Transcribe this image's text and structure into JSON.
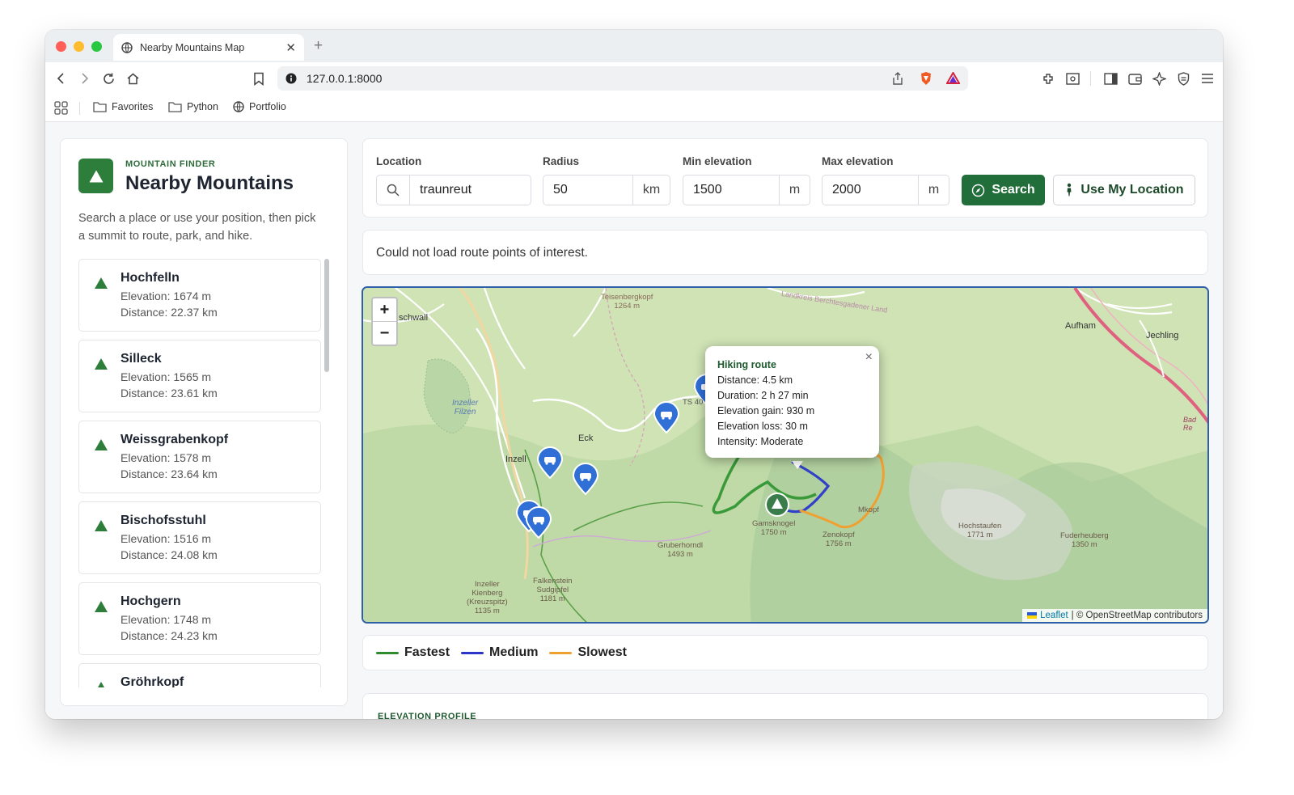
{
  "browser": {
    "tab_title": "Nearby Mountains Map",
    "url": "127.0.0.1:8000",
    "bookmarks": [
      "Favorites",
      "Python",
      "Portfolio"
    ],
    "traffic_light_colors": [
      "#fe5f57",
      "#febc2e",
      "#28c840"
    ]
  },
  "sidebar": {
    "eyebrow": "MOUNTAIN FINDER",
    "title": "Nearby Mountains",
    "intro": "Search a place or use your position, then pick a summit to route, park, and hike.",
    "mountains": [
      {
        "name": "Hochfelln",
        "elevation": "Elevation: 1674 m",
        "distance": "Distance: 22.37 km"
      },
      {
        "name": "Silleck",
        "elevation": "Elevation: 1565 m",
        "distance": "Distance: 23.61 km"
      },
      {
        "name": "Weissgrabenkopf",
        "elevation": "Elevation: 1578 m",
        "distance": "Distance: 23.64 km"
      },
      {
        "name": "Bischofsstuhl",
        "elevation": "Elevation: 1516 m",
        "distance": "Distance: 24.08 km"
      },
      {
        "name": "Hochgern",
        "elevation": "Elevation: 1748 m",
        "distance": "Distance: 24.23 km"
      },
      {
        "name": "Gröhrkopf",
        "elevation": "",
        "distance": ""
      }
    ]
  },
  "search": {
    "location_label": "Location",
    "location_value": "traunreut",
    "radius_label": "Radius",
    "radius_value": "50",
    "radius_unit": "km",
    "min_label": "Min elevation",
    "min_value": "1500",
    "min_unit": "m",
    "max_label": "Max elevation",
    "max_value": "2000",
    "max_unit": "m",
    "search_button": "Search",
    "location_button": "Use My Location"
  },
  "notice": "Could not load route points of interest.",
  "map": {
    "zoom_in": "+",
    "zoom_out": "−",
    "attribution_link": "Leaflet",
    "attribution_text": "| © OpenStreetMap contributors",
    "popup": {
      "title": "Hiking route",
      "distance": "Distance: 4.5 km",
      "duration": "Duration: 2 h 27 min",
      "gain": "Elevation gain: 930 m",
      "loss": "Elevation loss: 30 m",
      "intensity": "Intensity: Moderate",
      "close": "×"
    },
    "labels": {
      "inzell": "Inzell",
      "eck": "Eck",
      "aufham": "Aufham",
      "jechling": "Jechling",
      "schwall": "schwall",
      "teisenberg": "Teisenbergkopf",
      "teisenberg_elev": "1264 m",
      "gamsknogel": "Gamsknogel",
      "gamsknogel_elev": "1750 m",
      "zenokopf": "Zenokopf",
      "zenokopf_elev": "1756 m",
      "mkopf": "Mkopf",
      "gruberhorndl": "Gruberhorndl",
      "gruberhorndl_elev": "1493 m",
      "hochstaufen": "Hochstaufen",
      "hochstaufen_elev": "1771 m",
      "fuderheuberg": "Fuderheuberg",
      "fuderheuberg_elev": "1350 m",
      "falkenstein": "Falkenstein",
      "sudgipfel": "Sudgipfel",
      "falkenstein_elev": "1181 m",
      "inzeller": "Inzeller",
      "kienberg": "Kienberg",
      "kreuzspitz": "(Kreuzspitz)",
      "kreuz_elev": "1135 m",
      "ts40": "TS 40",
      "bad": "Bad Re",
      "landkreis": "Landkreis Berchtesgadener Land",
      "filzen1": "Inzeller",
      "filzen2": "Filzen"
    }
  },
  "legend": {
    "fastest": "Fastest",
    "medium": "Medium",
    "slowest": "Slowest",
    "colors": {
      "fastest": "#2e8b2e",
      "medium": "#2b36c8",
      "slowest": "#f0a030"
    }
  },
  "profile_title": "ELEVATION PROFILE",
  "accent_color": "#216e3a"
}
